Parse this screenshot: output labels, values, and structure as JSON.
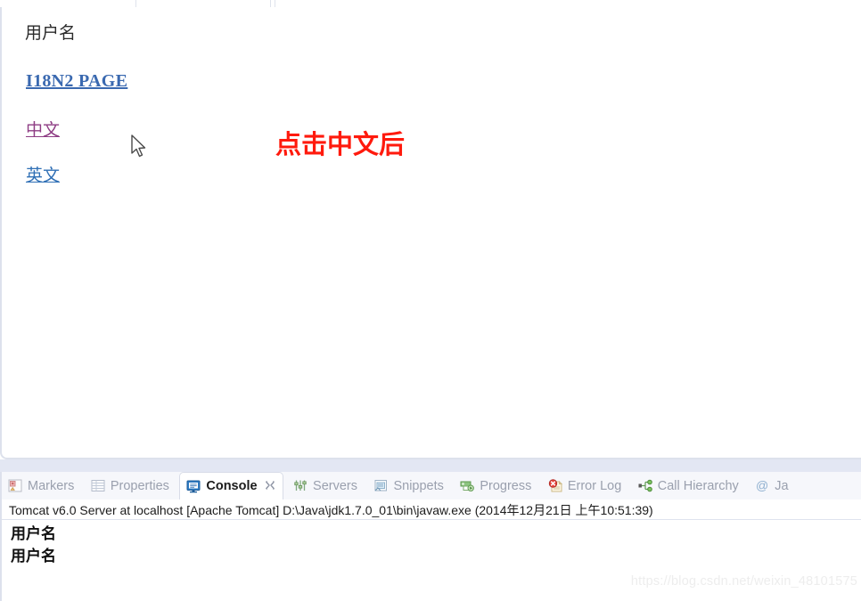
{
  "browser": {
    "heading": "用户名",
    "links": [
      {
        "name": "i18n2-page",
        "label": "I18N2 PAGE",
        "color": "#3a69b0",
        "state": "unvisited"
      },
      {
        "name": "chinese",
        "label": "中文",
        "color": "#8e3d84",
        "state": "visited"
      },
      {
        "name": "english",
        "label": "英文",
        "color": "#2f6fb5",
        "state": "unvisited"
      }
    ],
    "annotation": {
      "text": "点击中文后",
      "color": "#ff1a0d"
    },
    "cursor_icon": "arrow-pointer-icon"
  },
  "console_view": {
    "tabs": [
      {
        "label": "Markers",
        "icon": "markers-icon",
        "active": false,
        "closable": false
      },
      {
        "label": "Properties",
        "icon": "properties-icon",
        "active": false,
        "closable": false
      },
      {
        "label": "Console",
        "icon": "console-icon",
        "active": true,
        "closable": true
      },
      {
        "label": "Servers",
        "icon": "servers-icon",
        "active": false,
        "closable": false
      },
      {
        "label": "Snippets",
        "icon": "snippets-icon",
        "active": false,
        "closable": false
      },
      {
        "label": "Progress",
        "icon": "progress-icon",
        "active": false,
        "closable": false
      },
      {
        "label": "Error Log",
        "icon": "error-log-icon",
        "active": false,
        "closable": false
      },
      {
        "label": "Call Hierarchy",
        "icon": "call-hierarchy-icon",
        "active": false,
        "closable": false
      },
      {
        "label": "Ja",
        "icon": "javadoc-icon",
        "active": false,
        "closable": false
      }
    ],
    "process_line": "Tomcat v6.0 Server at localhost [Apache Tomcat] D:\\Java\\jdk1.7.0_01\\bin\\javaw.exe (2014年12月21日 上午10:51:39)",
    "output_lines": [
      "用户名",
      "用户名"
    ]
  },
  "watermark": "https://blog.csdn.net/weixin_48101575"
}
